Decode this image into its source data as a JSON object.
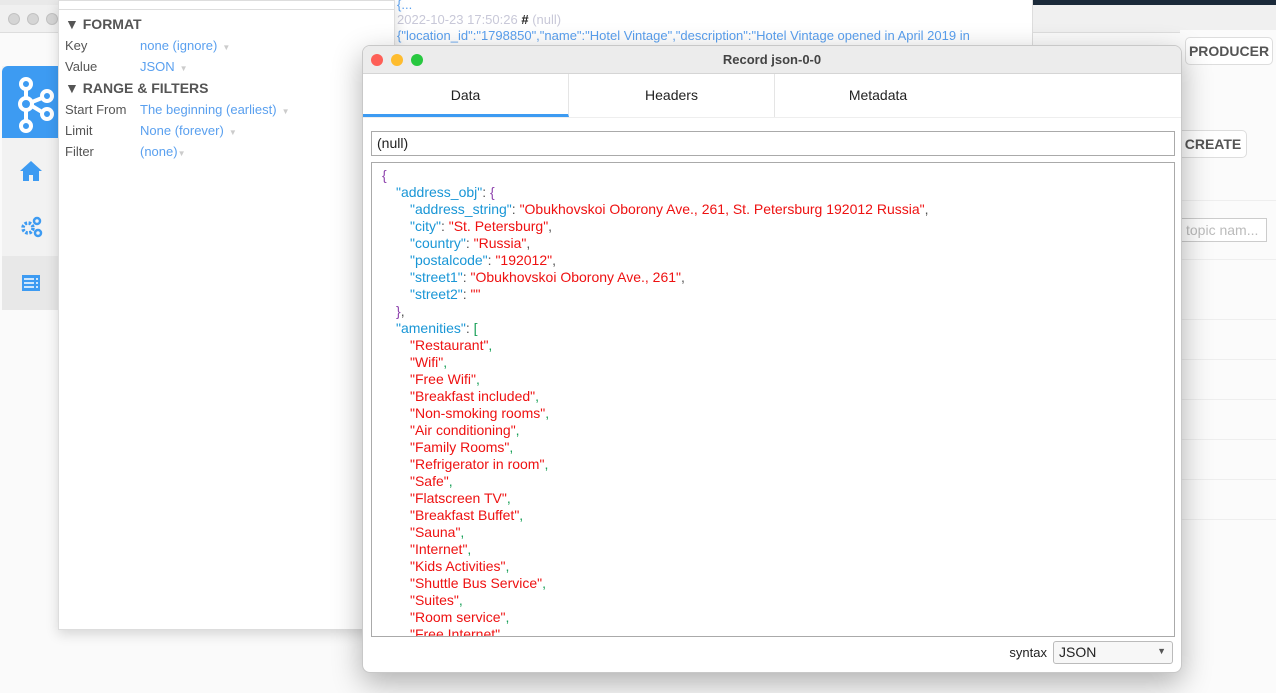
{
  "back_window": {
    "producer_label": "PRODUCER",
    "create_label": "CREATE",
    "topic_placeholder": "topic nam..."
  },
  "sidebar": {
    "items": [
      {
        "icon": "kafka-logo-icon"
      },
      {
        "icon": "home-icon"
      },
      {
        "icon": "gears-icon"
      },
      {
        "icon": "list-icon"
      }
    ]
  },
  "format_panel": {
    "format_title": "▼ FORMAT",
    "key_label": "Key",
    "key_value": "none (ignore)",
    "value_label": "Value",
    "value_value": "JSON",
    "range_title": "▼ RANGE & FILTERS",
    "start_label": "Start From",
    "start_value": "The beginning (earliest)",
    "limit_label": "Limit",
    "limit_value": "None (forever)",
    "filter_label": "Filter",
    "filter_value": "(none)"
  },
  "messages": {
    "prev_value": "{...",
    "timestamp": "2022-10-23 17:50:26",
    "hash": "#",
    "key": "(null)",
    "value_preview": "{\"location_id\":\"1798850\",\"name\":\"Hotel Vintage\",\"description\":\"Hotel  Vintage  opened in April 2019 in"
  },
  "record_dialog": {
    "title": "Record json-0-0",
    "tabs": [
      {
        "label": "Data"
      },
      {
        "label": "Headers"
      },
      {
        "label": "Metadata"
      }
    ],
    "active_tab": "Data",
    "key_value": "(null)",
    "syntax_label": "syntax",
    "syntax_value": "JSON",
    "address_obj": [
      [
        "address_string",
        "Obukhovskoi Oborony Ave., 261, St. Petersburg 192012 Russia"
      ],
      [
        "city",
        "St. Petersburg"
      ],
      [
        "country",
        "Russia"
      ],
      [
        "postalcode",
        "192012"
      ],
      [
        "street1",
        "Obukhovskoi Oborony Ave., 261"
      ],
      [
        "street2",
        ""
      ]
    ],
    "amenities": [
      "Restaurant",
      "Wifi",
      "Free Wifi",
      "Breakfast included",
      "Non-smoking rooms",
      "Air conditioning",
      "Family Rooms",
      "Refrigerator in room",
      "Safe",
      "Flatscreen TV",
      "Breakfast Buffet",
      "Sauna",
      "Internet",
      "Kids Activities",
      "Shuttle Bus Service",
      "Suites",
      "Room service",
      "Free Internet"
    ]
  },
  "colors": {
    "accent": "#3d9bf2",
    "json_key": "#1996d6",
    "json_string": "#ee1111",
    "json_brace": "#8e44ad",
    "json_bracket": "#18a058"
  }
}
